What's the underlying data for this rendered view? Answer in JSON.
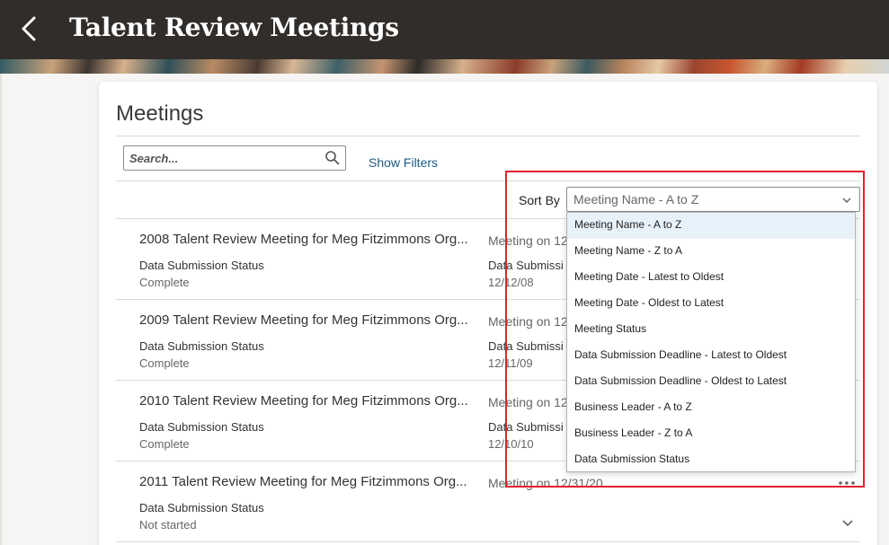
{
  "header": {
    "title": "Talent Review Meetings"
  },
  "meetings_panel": {
    "title": "Meetings",
    "search": {
      "placeholder": "Search...",
      "value": ""
    },
    "show_filters_label": "Show Filters",
    "sort": {
      "label": "Sort By",
      "selected": "Meeting Name - A to Z",
      "options": [
        "Meeting Name - A to Z",
        "Meeting Name - Z to A",
        "Meeting Date - Latest to Oldest",
        "Meeting Date - Oldest to Latest",
        "Meeting Status",
        "Data Submission Deadline - Latest to Oldest",
        "Data Submission Deadline - Oldest to Latest",
        "Business Leader - A to Z",
        "Business Leader - Z to A",
        "Data Submission Status"
      ]
    },
    "meetings": [
      {
        "name": "2008 Talent Review Meeting for Meg Fitzimmons Org...",
        "date": "Meeting on 12",
        "status_label": "Data Submission Status",
        "status": "Complete",
        "col2_label": "Data Submissi",
        "col2_value": "12/12/08"
      },
      {
        "name": "2009 Talent Review Meeting for Meg Fitzimmons Org...",
        "date": "Meeting on 12",
        "status_label": "Data Submission Status",
        "status": "Complete",
        "col2_label": "Data Submissi",
        "col2_value": "12/11/09"
      },
      {
        "name": "2010 Talent Review Meeting for Meg Fitzimmons Org...",
        "date": "Meeting on 12",
        "status_label": "Data Submission Status",
        "status": "Complete",
        "col2_label": "Data Submissi",
        "col2_value": "12/10/10"
      },
      {
        "name": "2011 Talent Review Meeting for Meg Fitzimmons Org...",
        "date": "Meeting on 12/31/20",
        "status_label": "Data Submission Status",
        "status": "Not started",
        "col2_label": "",
        "col2_value": ""
      }
    ]
  },
  "colors": {
    "header_bg": "#312d2a",
    "link": "#1c5b84",
    "highlight": "#e3212b",
    "selected_option_bg": "#e7f1fa"
  },
  "icons": {
    "back": "chevron-left-icon",
    "search": "magnifier-icon",
    "sort": "chevron-down-icon",
    "more": "ellipsis-icon",
    "expand": "chevron-down-icon"
  }
}
